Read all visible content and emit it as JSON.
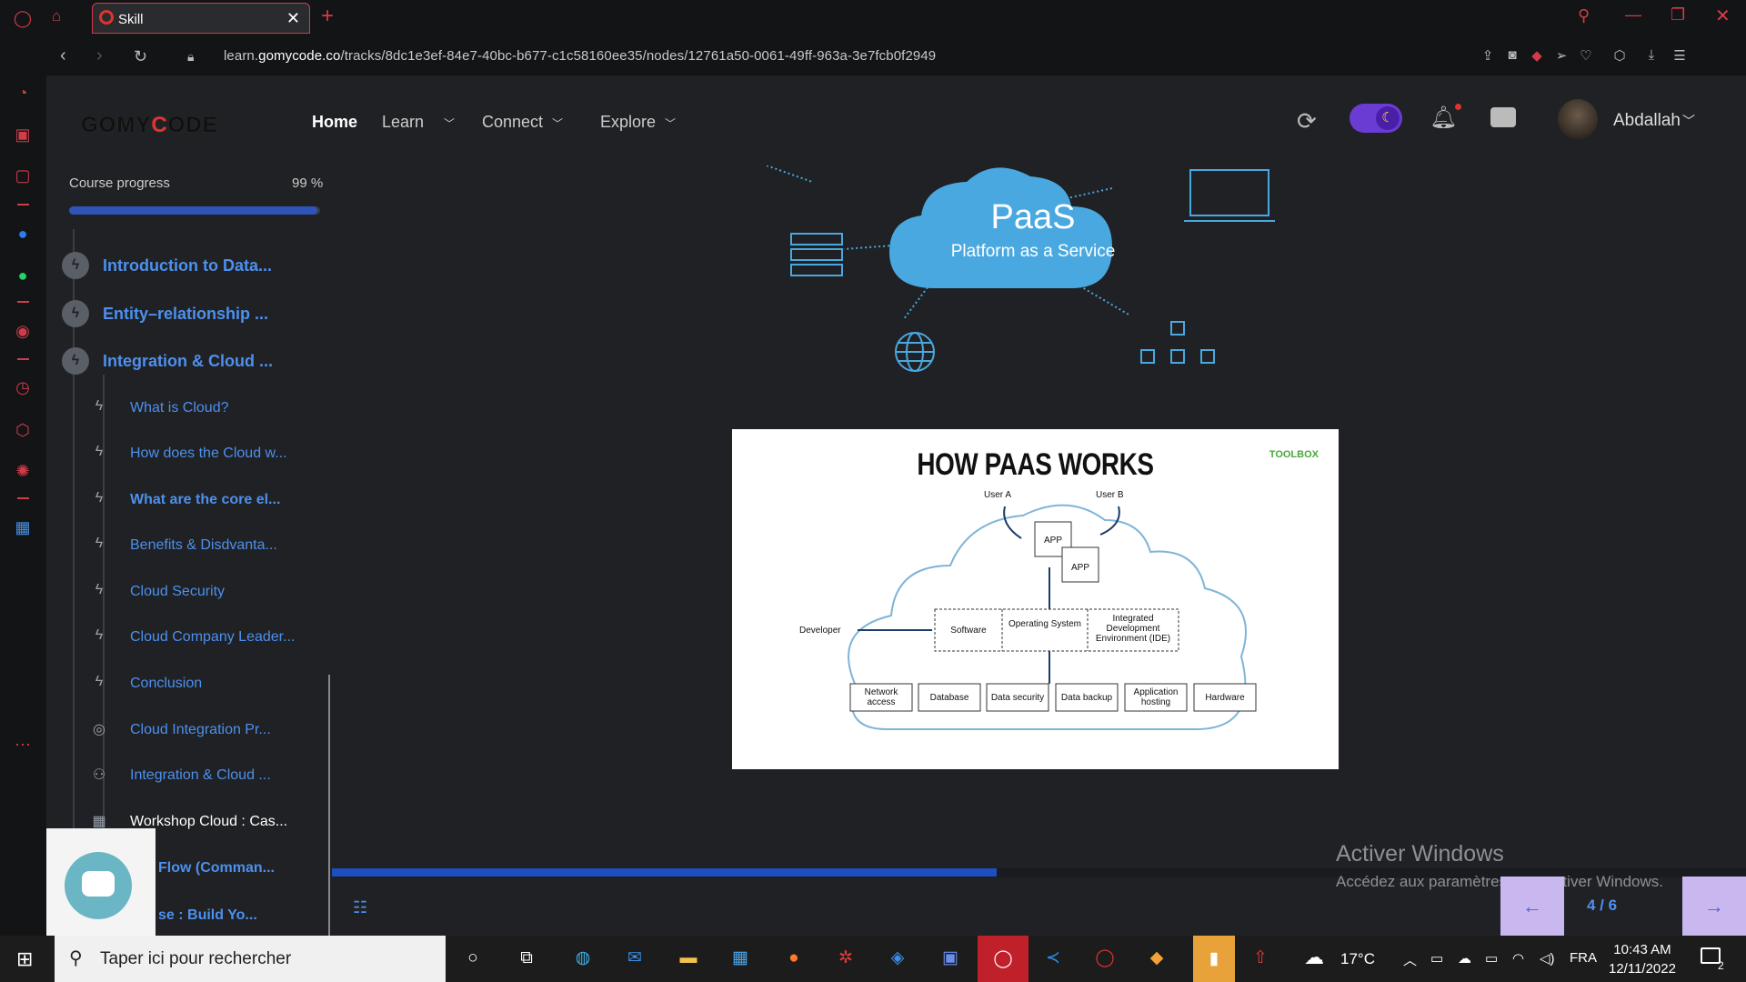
{
  "browser": {
    "tab_title": "Skill",
    "tab_close": "✕",
    "new_tab": "+",
    "url_prefix": "learn.",
    "url_domain": "gomycode.co",
    "url_path": "/tracks/8dc1e3ef-84e7-40bc-b677-c1c58160ee35/nodes/12761a50-0061-49ff-963a-3e7fcb0f2949"
  },
  "header": {
    "logo": "GOMYCODE",
    "nav": [
      {
        "label": "Home"
      },
      {
        "label": "Learn"
      },
      {
        "label": "Connect"
      },
      {
        "label": "Explore"
      }
    ],
    "username": "Abdallah"
  },
  "sidebar": {
    "progress_label": "Course progress",
    "progress_value": "99 %",
    "progress_fraction": 0.99,
    "sections": [
      {
        "label": "Introduction to Data..."
      },
      {
        "label": "Entity–relationship ..."
      },
      {
        "label": "Integration & Cloud ..."
      }
    ],
    "items": [
      {
        "label": "What is Cloud?",
        "icon": "bolt-icon"
      },
      {
        "label": "How does the Cloud w...",
        "icon": "bolt-icon"
      },
      {
        "label": "What are the core el...",
        "icon": "bolt-icon"
      },
      {
        "label": "Benefits & Disdvanta...",
        "icon": "bolt-icon"
      },
      {
        "label": "Cloud Security",
        "icon": "bolt-icon"
      },
      {
        "label": "Cloud Company Leader...",
        "icon": "bolt-icon"
      },
      {
        "label": "Conclusion",
        "icon": "bolt-icon"
      },
      {
        "label": "Cloud Integration Pr...",
        "icon": "target-icon"
      },
      {
        "label": "Integration & Cloud ...",
        "icon": "people-icon"
      },
      {
        "label": "Workshop Cloud : Cas...",
        "icon": "board-icon"
      },
      {
        "label": "Flow (Comman...",
        "icon": "bolt-icon"
      },
      {
        "label": "se : Build Yo...",
        "icon": "bolt-icon"
      }
    ]
  },
  "slide": {
    "cloud_title": "PaaS",
    "cloud_subtitle": "Platform as a Service",
    "diagram": {
      "title": "HOW PAAS WORKS",
      "brand": "TOOLBOX",
      "user_a": "User A",
      "user_b": "User B",
      "app1": "APP",
      "app2": "APP",
      "developer": "Developer",
      "software": "Software",
      "os": "Operating System",
      "ide": "Integrated Development Environment (IDE)",
      "bottom": [
        "Network access",
        "Database",
        "Data security",
        "Data backup",
        "Application hosting",
        "Hardware"
      ]
    },
    "slide_progress_fraction": 0.47,
    "page_counter": "4 / 6",
    "prev_icon": "←",
    "next_icon": "→"
  },
  "watermark": {
    "line1": "Activer Windows",
    "line2": "Accédez aux paramètres pour activer Windows."
  },
  "taskbar": {
    "search_placeholder": "Taper ici pour rechercher",
    "weather": "17°C",
    "lang": "FRA",
    "time": "10:43 AM",
    "date": "12/11/2022",
    "notif_count": "2"
  },
  "colors": {
    "accent_blue": "#4d90ee",
    "progress_blue": "#2f54b8",
    "opera_red": "#d23c4a",
    "cloud_blue": "#4aa8e0"
  }
}
